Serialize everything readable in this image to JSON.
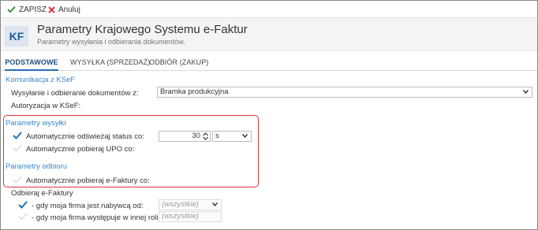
{
  "toolbar": {
    "save_label": "ZAPISZ",
    "cancel_label": "Anuluj"
  },
  "header": {
    "badge": "KF",
    "title": "Parametry Krajowego Systemu e-Faktur",
    "subtitle": "Parametry wysyłania i odbierania dokumentów."
  },
  "tabs": [
    {
      "label": "PODSTAWOWE",
      "active": true
    },
    {
      "label": "WYSYŁKA (SPRZEDAŻ)",
      "active": false
    },
    {
      "label": "ODBIÓR (ZAKUP)",
      "active": false
    }
  ],
  "ksef": {
    "section_title": "Komunikacja z KSeF",
    "mode_label": "Wysyłanie i odbieranie dokumentów z:",
    "mode_value": "Bramka produkcyjna",
    "auth_label": "Autoryzacja w KSeF:"
  },
  "sending": {
    "section_title": "Parametry wysyłki",
    "refresh_label": "Automatycznie odświeżaj status co:",
    "refresh_checked": true,
    "refresh_value": "30",
    "refresh_unit": "s",
    "upo_label": "Automatycznie pobieraj UPO co:",
    "upo_checked": false
  },
  "receiving": {
    "section_title": "Parametry odbioru",
    "auto_label": "Automatycznie pobieraj e-Faktury co:",
    "auto_checked": false,
    "group_label": "Odbieraj e-Faktury",
    "buyer_label": "- gdy moja firma jest nabywcą od:",
    "buyer_checked": true,
    "buyer_value": "(wszystkie)",
    "other_label": "- gdy moja firma występuje w innej roli od:",
    "other_checked": false,
    "other_value": "(wszystkie)"
  },
  "colors": {
    "accent": "#2a6db5",
    "section": "#3a86c8",
    "check": "#1e73b8",
    "highlight": "#d9363e",
    "save_icon": "#3a9d3a",
    "cancel_icon": "#d9363e"
  }
}
